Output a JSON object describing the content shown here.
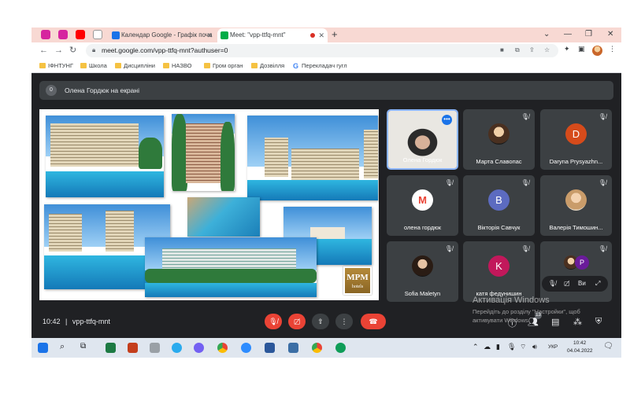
{
  "browser": {
    "tabs": [
      {
        "label": "Календар Google - Графік поча",
        "icon": "google-calendar-icon",
        "color": "#1a73e8"
      },
      {
        "label": "Meet: \"vpp-ttfq-mnt\"",
        "icon": "google-meet-icon",
        "color": "#00ac47",
        "active": true
      }
    ],
    "pinned_tabs": [
      {
        "icon": "instagram-icon",
        "color": "#d6249f"
      },
      {
        "icon": "instagram-icon",
        "color": "#d6249f"
      },
      {
        "icon": "youtube-icon",
        "color": "#ff0000"
      },
      {
        "icon": "rkf-icon",
        "color": "#ffffff"
      }
    ],
    "url": "meet.google.com/vpp-ttfq-mnt?authuser=0",
    "bookmarks": [
      {
        "label": "ІФНТУНГ",
        "icon": "folder-icon"
      },
      {
        "label": "Школа",
        "icon": "folder-icon"
      },
      {
        "label": "Дисципліни",
        "icon": "folder-icon"
      },
      {
        "label": "НАЗВО",
        "icon": "folder-icon"
      },
      {
        "label": "Гром орган",
        "icon": "folder-icon"
      },
      {
        "label": "Дозвілля",
        "icon": "folder-icon"
      },
      {
        "label": "Перекладач гугл",
        "icon": "google-translate-icon"
      }
    ]
  },
  "meet": {
    "presenting_count": "0",
    "presenting_text": "Олена Гордюк на екрані",
    "meeting_time": "10:42",
    "meeting_code": "vpp-ttfq-mnt",
    "slide_logo": {
      "line1": "MPM",
      "line2": "hotels"
    },
    "participants": [
      {
        "name": "Олена Гордюк",
        "kind": "camera",
        "speaking": true
      },
      {
        "name": "Марта Славопас",
        "kind": "photo",
        "muted": true
      },
      {
        "name": "Daryna Prysyazhn...",
        "kind": "letter",
        "letter": "D",
        "color": "#d64b1b",
        "muted": true
      },
      {
        "name": "олена гордюк",
        "kind": "gmail",
        "muted": true
      },
      {
        "name": "Вікторія Савчук",
        "kind": "letter",
        "letter": "B",
        "color": "#5c6bc0",
        "muted": true
      },
      {
        "name": "Валерія Тимошин...",
        "kind": "photo",
        "muted": true
      },
      {
        "name": "Sofia Maletyn",
        "kind": "photo",
        "muted": true
      },
      {
        "name": "катя федунишин",
        "kind": "letter",
        "letter": "K",
        "color": "#c2185b",
        "muted": true
      }
    ],
    "overflow_tile": {
      "letter": "P",
      "label": "Ви"
    },
    "participant_badge": "13",
    "watermark": {
      "title": "Активація Windows",
      "line1": "Перейдіть до розділу \"Настройки\", щоб",
      "line2": "активувати Windows."
    }
  },
  "taskbar": {
    "language": "УКР",
    "time": "10:42",
    "date": "04.04.2022"
  }
}
